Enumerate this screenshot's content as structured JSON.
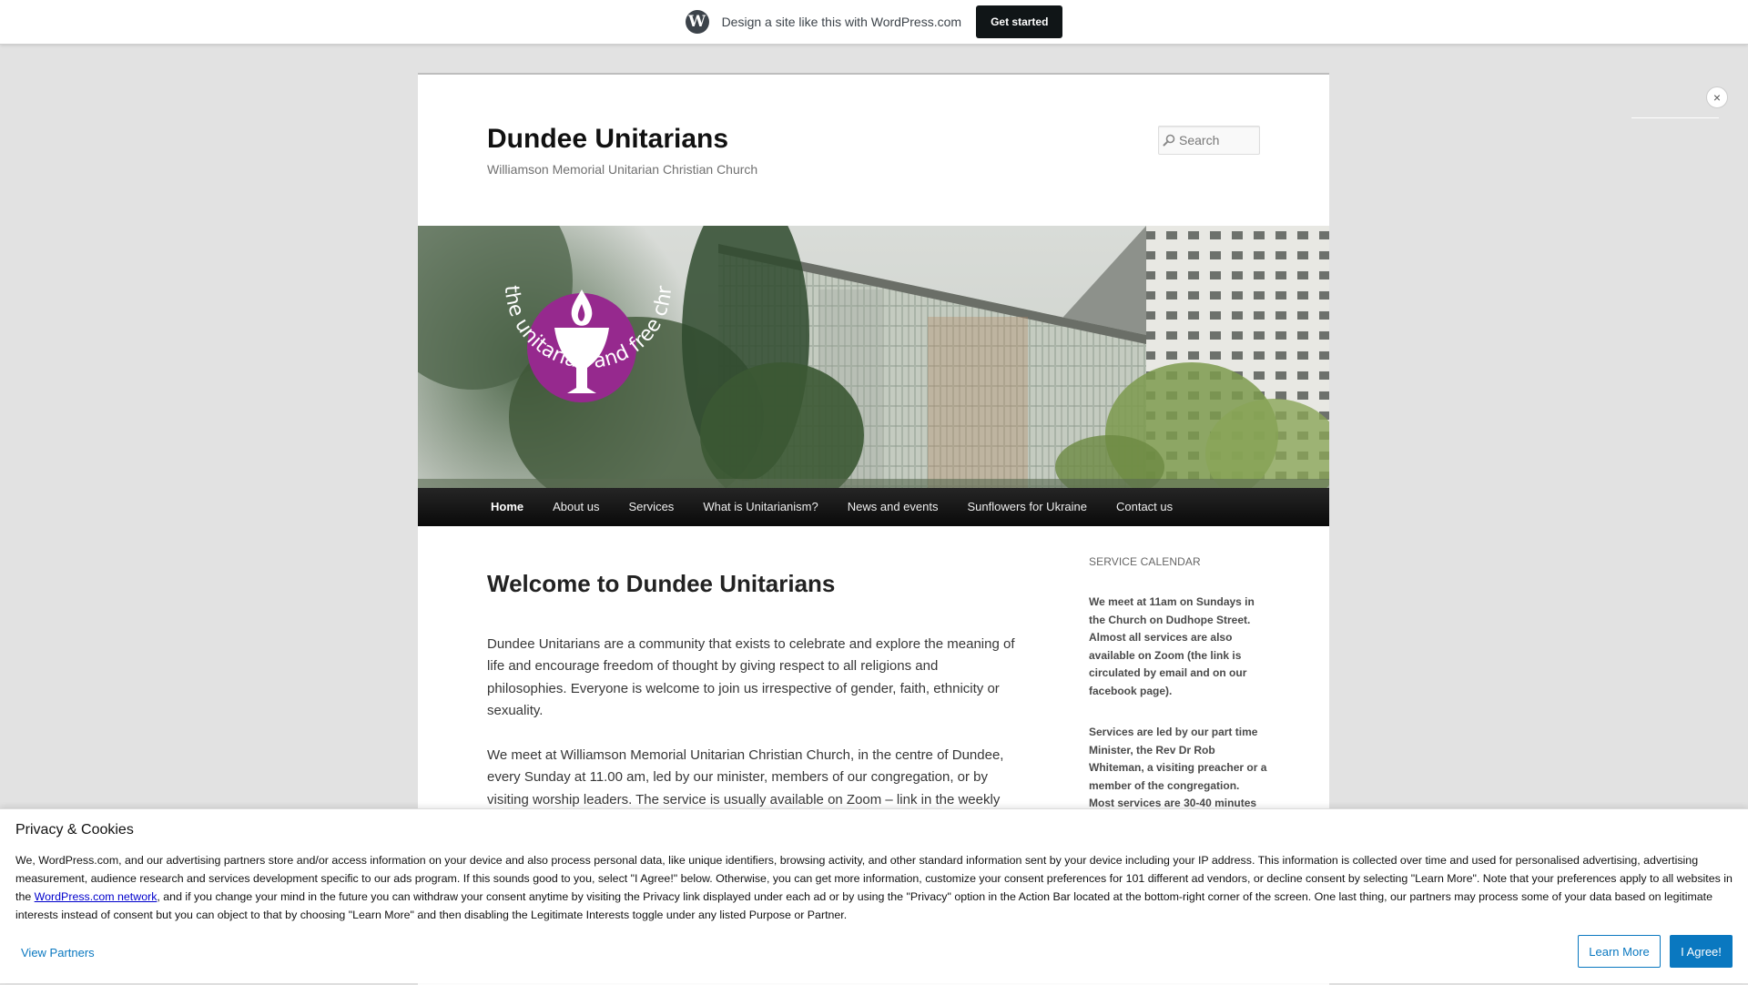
{
  "wp_banner": {
    "logo_glyph": "W",
    "text": "Design a site like this with WordPress.com",
    "cta_label": "Get started"
  },
  "site": {
    "title": "Dundee Unitarians",
    "description": "Williamson Memorial Unitarian Christian Church",
    "search_placeholder": "Search"
  },
  "header_image": {
    "logo_ring_text": "the unitarian and free christian churches",
    "logo_color": "#96298e"
  },
  "nav": {
    "items": [
      {
        "label": "Home",
        "active": true
      },
      {
        "label": "About us"
      },
      {
        "label": "Services"
      },
      {
        "label": "What is Unitarianism?"
      },
      {
        "label": "News and events"
      },
      {
        "label": "Sunflowers for Ukraine"
      },
      {
        "label": "Contact us"
      }
    ]
  },
  "main": {
    "title": "Welcome to Dundee Unitarians",
    "paragraphs": [
      "Dundee Unitarians are a community that exists to celebrate and explore the meaning of life and encourage freedom of thought by giving respect to all religions and philosophies. Everyone is welcome to join us irrespective of gender, faith, ethnicity or sexuality.",
      "We meet at Williamson Memorial Unitarian Christian Church, in the centre of Dundee, every Sunday at 11.00 am, led by our minister, members of our congregation, or by visiting worship leaders. The service is usually available on Zoom – link in the weekly"
    ]
  },
  "sidebar": {
    "widget_title": "SERVICE CALENDAR",
    "paragraphs": [
      "We meet at 11am on Sundays in the Church on Dudhope Street. Almost all services are also available on Zoom (the link is circulated by email and on our facebook page).",
      "Services are led by our part time Minister, the Rev Dr Rob Whiteman, a visiting preacher or a member of the congregation. Most services are 30-40 minutes"
    ]
  },
  "overlay": {
    "close_glyph": "×"
  },
  "cookie": {
    "title": "Privacy & Cookies",
    "body_before_link": "We, WordPress.com, and our advertising partners store and/or access information on your device and also process personal data, like unique identifiers, browsing activity, and other standard information sent by your device including your IP address. This information is collected over time and used for personalised advertising, advertising measurement, audience research and services development specific to our ads program. If this sounds good to you, select \"I Agree!\" below. Otherwise, you can get more information, customize your consent preferences for 101 different ad vendors, or decline consent by selecting \"Learn More\". Note that your preferences apply to all websites in the ",
    "link_text": "WordPress.com network",
    "body_after_link": ", and if you change your mind in the future you can withdraw your consent anytime by visiting the Privacy link displayed under each ad or by using the \"Privacy\" option in the Action Bar located at the bottom-right corner of the screen. One last thing, our partners may process some of your data based on legitimate interests instead of consent but you can object to that by choosing \"Learn More\" and then disabling the Legitimate Interests toggle under any listed Purpose or Partner.",
    "view_partners": "View Partners",
    "learn_more": "Learn More",
    "agree": "I Agree!"
  }
}
